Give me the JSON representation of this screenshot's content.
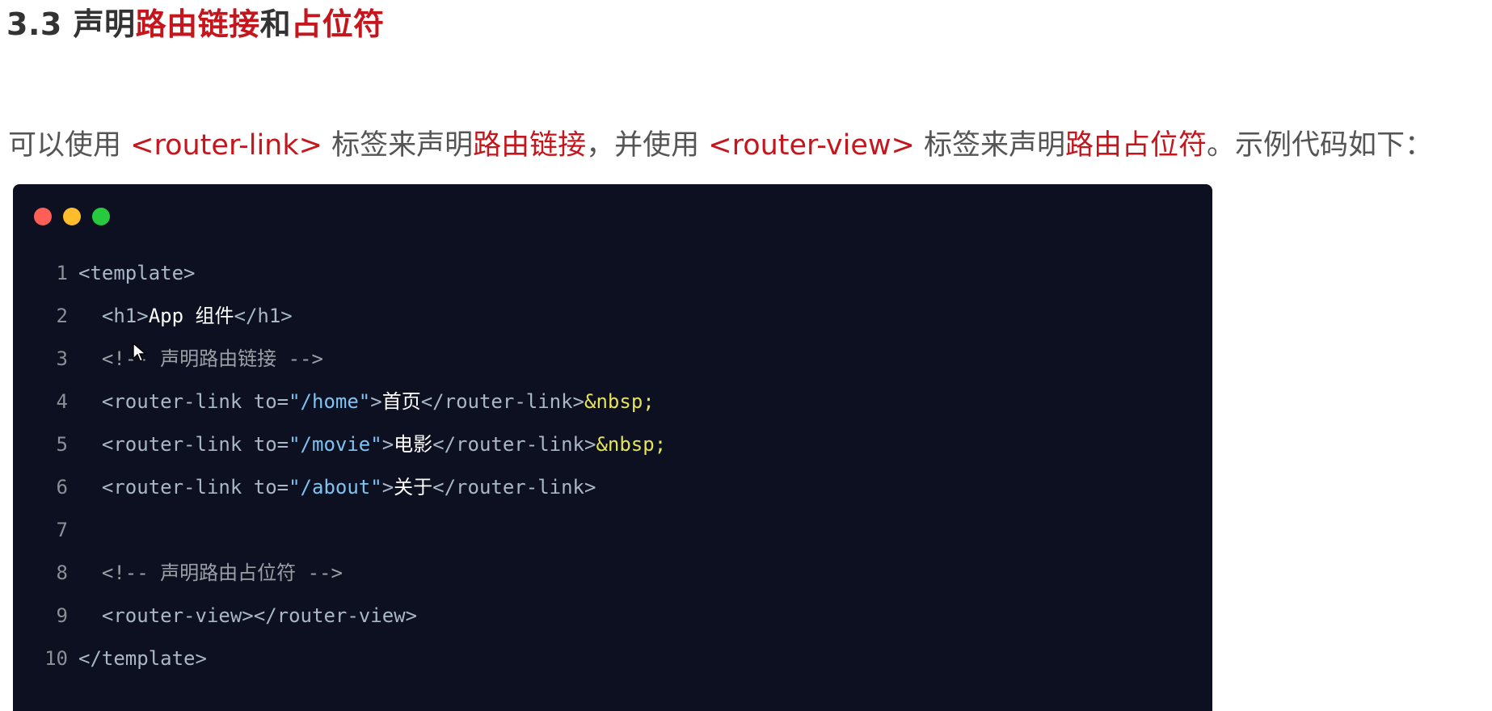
{
  "heading": {
    "number": "3.3 ",
    "part1": "声明",
    "part2": "路由链接",
    "part3": "和",
    "part4": "占位符"
  },
  "paragraph": {
    "t1": "可以使用 ",
    "tag1": "<router-link>",
    "t2": " 标签来声明",
    "accent1": "路由链接",
    "t3": "，并使用 ",
    "tag2": "<router-view>",
    "t4": " 标签来声明",
    "accent2": "路由占位符",
    "t5": "。示例代码如下："
  },
  "code": {
    "lines": [
      {
        "n": "1",
        "a": "<template>"
      },
      {
        "n": "2",
        "indent": "  ",
        "open": "<h1>",
        "text": "App 组件",
        "close": "</h1>"
      },
      {
        "n": "3",
        "indent": "  ",
        "comment": "<!-- 声明路由链接 -->"
      },
      {
        "n": "4",
        "indent": "  ",
        "open": "<router-link ",
        "attr": "to=",
        "str": "\"/home\"",
        "gt": ">",
        "text": "首页",
        "close": "</router-link>",
        "ent": "&nbsp;"
      },
      {
        "n": "5",
        "indent": "  ",
        "open": "<router-link ",
        "attr": "to=",
        "str": "\"/movie\"",
        "gt": ">",
        "text": "电影",
        "close": "</router-link>",
        "ent": "&nbsp;"
      },
      {
        "n": "6",
        "indent": "  ",
        "open": "<router-link ",
        "attr": "to=",
        "str": "\"/about\"",
        "gt": ">",
        "text": "关于",
        "close": "</router-link>"
      },
      {
        "n": "7"
      },
      {
        "n": "8",
        "indent": "  ",
        "comment": "<!-- 声明路由占位符 -->"
      },
      {
        "n": "9",
        "indent": "  ",
        "open": "<router-view>",
        "close": "</router-view>"
      },
      {
        "n": "10",
        "a": "</template>"
      }
    ]
  },
  "window_controls": [
    "close-dot",
    "minimize-dot",
    "maximize-dot"
  ],
  "colors": {
    "accent": "#c4161c",
    "code_bg": "#0c1021",
    "dot_red": "#ff5f56",
    "dot_yellow": "#ffbd2e",
    "dot_green": "#27c93f"
  }
}
